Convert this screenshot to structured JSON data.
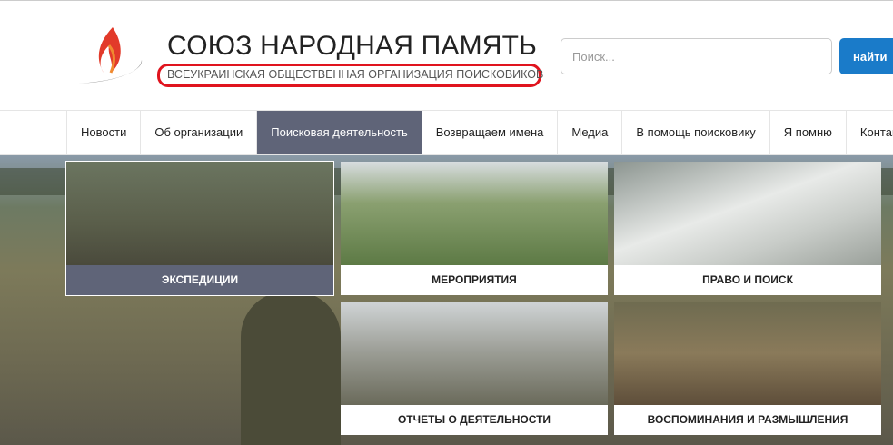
{
  "header": {
    "title": "СОЮЗ НАРОДНАЯ ПАМЯТЬ",
    "subtitle": "ВСЕУКРАИНСКАЯ ОБЩЕСТВЕННАЯ ОРГАНИЗАЦИЯ ПОИСКОВИКОВ"
  },
  "search": {
    "placeholder": "Поиск...",
    "button": "найти"
  },
  "nav": [
    "Новости",
    "Об организации",
    "Поисковая деятельность",
    "Возвращаем имена",
    "Медиа",
    "В помощь поисковику",
    "Я помню",
    "Контакты"
  ],
  "tiles": [
    "ЭКСПЕДИЦИИ",
    "МЕРОПРИЯТИЯ",
    "ПРАВО И ПОИСК",
    "ОТЧЕТЫ О ДЕЯТЕЛЬНОСТИ",
    "ВОСПОМИНАНИЯ И РАЗМЫШЛЕНИЯ"
  ],
  "colors": {
    "accent": "#1a7bc9",
    "active": "#5f6478",
    "highlight": "#e0141e"
  }
}
